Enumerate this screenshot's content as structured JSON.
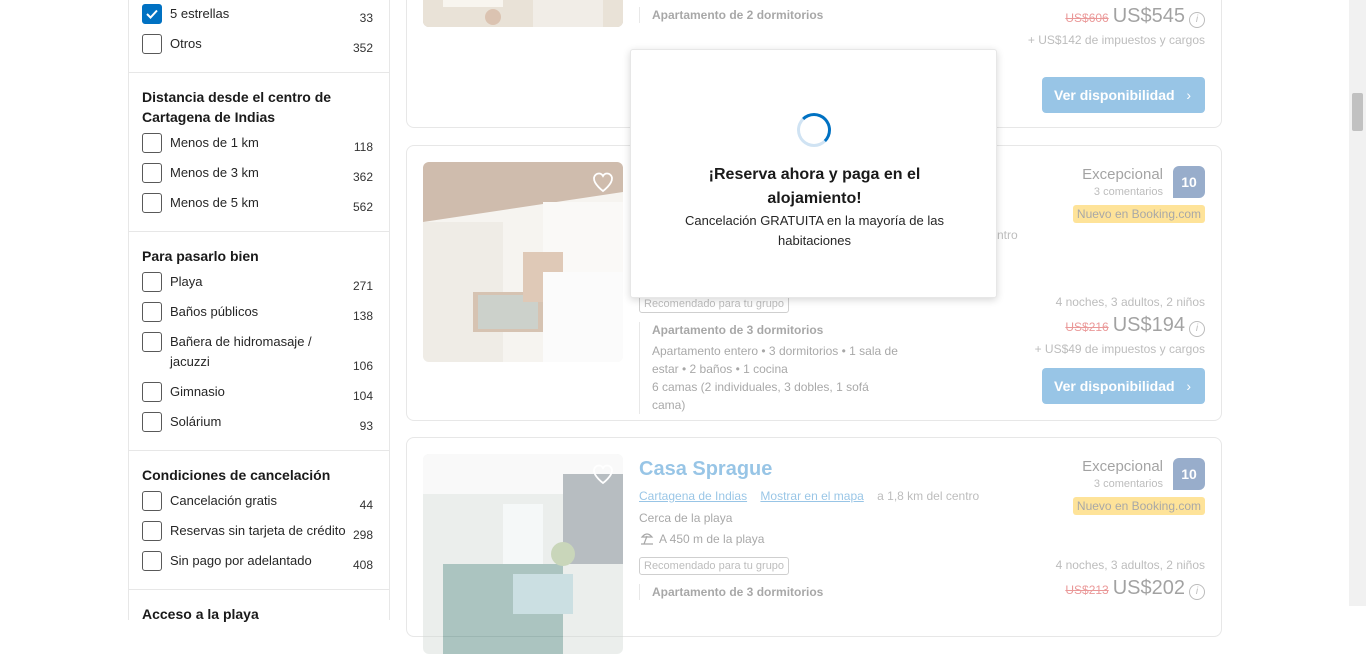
{
  "filters": {
    "stars": [
      {
        "label": "5 estrellas",
        "count": "33",
        "checked": true
      },
      {
        "label": "Otros",
        "count": "352",
        "checked": false
      }
    ],
    "distance": {
      "title": "Distancia desde el centro de Cartagena de Indias",
      "items": [
        {
          "label": "Menos de 1 km",
          "count": "118"
        },
        {
          "label": "Menos de 3 km",
          "count": "362"
        },
        {
          "label": "Menos de 5 km",
          "count": "562"
        }
      ]
    },
    "fun": {
      "title": "Para pasarlo bien",
      "items": [
        {
          "label": "Playa",
          "count": "271"
        },
        {
          "label": "Baños públicos",
          "count": "138"
        },
        {
          "label": "Bañera de hidromasaje / jacuzzi",
          "count": "106"
        },
        {
          "label": "Gimnasio",
          "count": "104"
        },
        {
          "label": "Solárium",
          "count": "93"
        }
      ]
    },
    "cancellation": {
      "title": "Condiciones de cancelación",
      "items": [
        {
          "label": "Cancelación gratis",
          "count": "44"
        },
        {
          "label": "Reservas sin tarjeta de crédito",
          "count": "298"
        },
        {
          "label": "Sin pago por adelantado",
          "count": "408"
        }
      ]
    },
    "beach_access": {
      "title": "Acceso a la playa"
    }
  },
  "cards": [
    {
      "room_type": "Apartamento de 2 dormitorios",
      "old_price": "US$606",
      "new_price": "US$545",
      "tax": "+ US$142 de impuestos y cargos",
      "cta": "Ver disponibilidad"
    },
    {
      "rating_word": "Excepcional",
      "rating_count": "3 comentarios",
      "score": "10",
      "new_badge": "Nuevo en Booking.com",
      "distance_tail": "ntro",
      "rec_badge": "Recomendado para tu grupo",
      "room_type": "Apartamento de 3 dormitorios",
      "room_desc": "Apartamento entero • 3 dormitorios • 1 sala de estar • 2 baños • 1 cocina",
      "beds": "6 camas (2 individuales, 3 dobles, 1 sofá cama)",
      "stay_info": "4 noches, 3 adultos, 2 niños",
      "old_price": "US$216",
      "new_price": "US$194",
      "tax": "+ US$49 de impuestos y cargos",
      "cta": "Ver disponibilidad"
    },
    {
      "title": "Casa Sprague",
      "link_city": "Cartagena de Indias",
      "link_map": "Mostrar en el mapa",
      "distance": "a 1,8 km del centro",
      "near": "Cerca de la playa",
      "beach": "A 450 m de la playa",
      "rating_word": "Excepcional",
      "rating_count": "3 comentarios",
      "score": "10",
      "new_badge": "Nuevo en Booking.com",
      "rec_badge": "Recomendado para tu grupo",
      "room_type": "Apartamento de 3 dormitorios",
      "stay_info": "4 noches, 3 adultos, 2 niños",
      "old_price": "US$213",
      "new_price": "US$202"
    }
  ],
  "modal": {
    "title": "¡Reserva ahora y paga en el alojamiento!",
    "subtitle": "Cancelación GRATUITA en la mayoría de las habitaciones"
  },
  "icons": {
    "info": "i",
    "chevron": "›"
  }
}
